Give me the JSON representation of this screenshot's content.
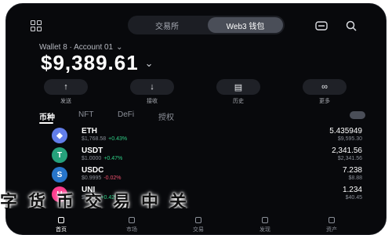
{
  "header": {
    "tabs": [
      {
        "label": "交易所",
        "active": false
      },
      {
        "label": "Web3 钱包",
        "active": true
      }
    ],
    "icons": [
      "grid-icon",
      "scan-icon",
      "search-icon"
    ]
  },
  "account": {
    "label": "Wallet 8 · Account 01",
    "balance": "$9,389.61"
  },
  "actions": [
    {
      "label": "发送",
      "icon": "arrow-up-icon",
      "glyph": "↑"
    },
    {
      "label": "接收",
      "icon": "arrow-down-icon",
      "glyph": "↓"
    },
    {
      "label": "历史",
      "icon": "history-icon",
      "glyph": "▤"
    },
    {
      "label": "更多",
      "icon": "more-icon",
      "glyph": "∞"
    }
  ],
  "asset_tabs": [
    "币种",
    "NFT",
    "DeFi",
    "授权"
  ],
  "assets": [
    {
      "symbol": "ETH",
      "price": "$1,768.58",
      "change": "+0.43%",
      "amount": "5.435949",
      "value": "$9,595.30",
      "color": "#627eea",
      "glyph": "◆"
    },
    {
      "symbol": "USDT",
      "price": "$1.0000",
      "change": "+0.47%",
      "amount": "2,341.56",
      "value": "$2,341.56",
      "color": "#26a17b",
      "glyph": "T"
    },
    {
      "symbol": "USDC",
      "price": "$0.9995",
      "change": "-0.02%",
      "amount": "7.238",
      "value": "$8.88",
      "color": "#2775ca",
      "glyph": "S"
    },
    {
      "symbol": "UNI",
      "price": "$12.33",
      "change": "+0.42%",
      "amount": "1.234",
      "value": "$40.45",
      "color": "#ff3c8e",
      "glyph": "U"
    }
  ],
  "bottom_nav": [
    "首页",
    "市场",
    "交易",
    "发现",
    "资产"
  ],
  "overlay_text": "字货币交易中关"
}
